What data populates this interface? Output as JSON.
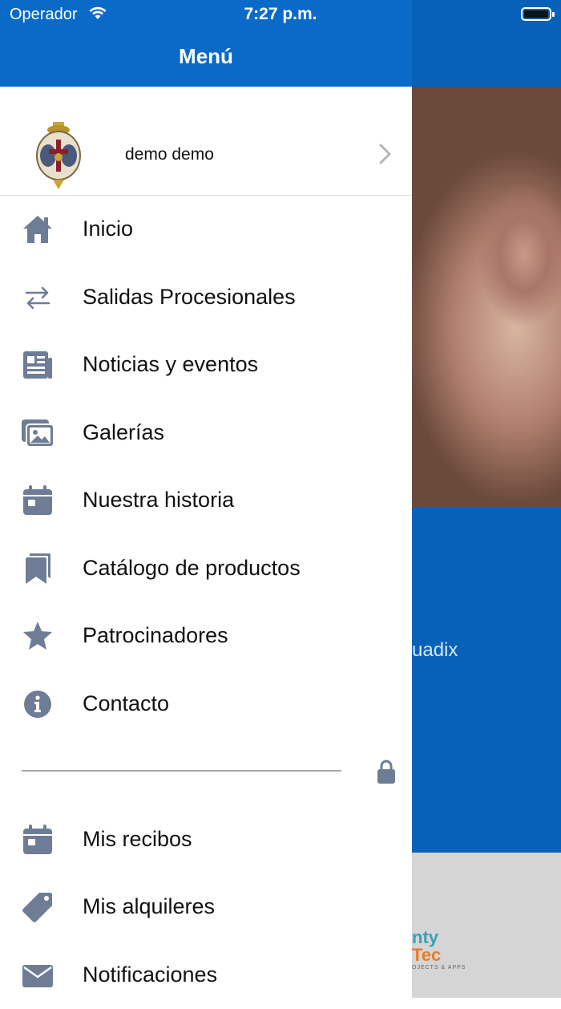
{
  "status_bar": {
    "carrier": "Operador",
    "time": "7:27 p.m."
  },
  "header": {
    "title": "Menú"
  },
  "profile": {
    "name": "demo demo"
  },
  "menu": {
    "items": [
      {
        "label": "Inicio",
        "icon": "home-icon"
      },
      {
        "label": "Salidas Procesionales",
        "icon": "swap-arrows-icon"
      },
      {
        "label": "Noticias y eventos",
        "icon": "newspaper-icon"
      },
      {
        "label": "Galerías",
        "icon": "gallery-icon"
      },
      {
        "label": "Nuestra historia",
        "icon": "calendar-icon"
      },
      {
        "label": "Catálogo de productos",
        "icon": "bookmarks-icon"
      },
      {
        "label": "Patrocinadores",
        "icon": "star-icon"
      },
      {
        "label": "Contacto",
        "icon": "info-icon"
      }
    ],
    "private_items": [
      {
        "label": "Mis recibos",
        "icon": "calendar-icon"
      },
      {
        "label": "Mis alquileres",
        "icon": "tag-icon"
      },
      {
        "label": "Notificaciones",
        "icon": "envelope-icon"
      }
    ]
  },
  "background_page": {
    "text_fragment": "uadix",
    "logo_line1": "nty",
    "logo_line2": "Tec",
    "logo_line3": "OJECTS & APPS"
  },
  "colors": {
    "header_blue": "#0a6ac8",
    "icon_gray": "#6e7d95",
    "page_blue": "#0861b8"
  }
}
